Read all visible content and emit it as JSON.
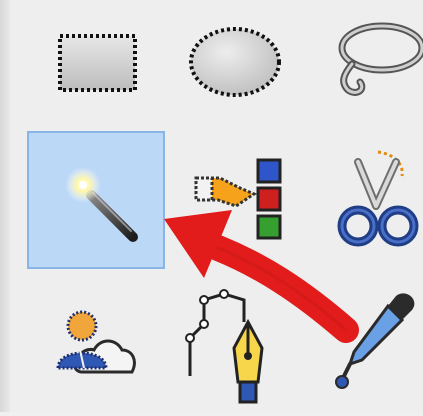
{
  "toolbox": {
    "tools": [
      {
        "name": "Rectangle Select",
        "icon": "rectangle-select-icon",
        "active": false
      },
      {
        "name": "Ellipse Select",
        "icon": "ellipse-select-icon",
        "active": false
      },
      {
        "name": "Free Select",
        "icon": "lasso-icon",
        "active": false
      },
      {
        "name": "Fuzzy Select",
        "icon": "magic-wand-icon",
        "active": true
      },
      {
        "name": "Select by Color",
        "icon": "select-by-color-icon",
        "active": false
      },
      {
        "name": "Scissors Select",
        "icon": "scissors-icon",
        "active": false
      },
      {
        "name": "Foreground Select",
        "icon": "foreground-select-icon",
        "active": false
      },
      {
        "name": "Paths",
        "icon": "paths-pen-icon",
        "active": false
      },
      {
        "name": "Color Picker",
        "icon": "color-picker-icon",
        "active": false
      }
    ],
    "pointer_arrow_color": "#e21b1b",
    "active_highlight_color": "#bcd8f7"
  }
}
